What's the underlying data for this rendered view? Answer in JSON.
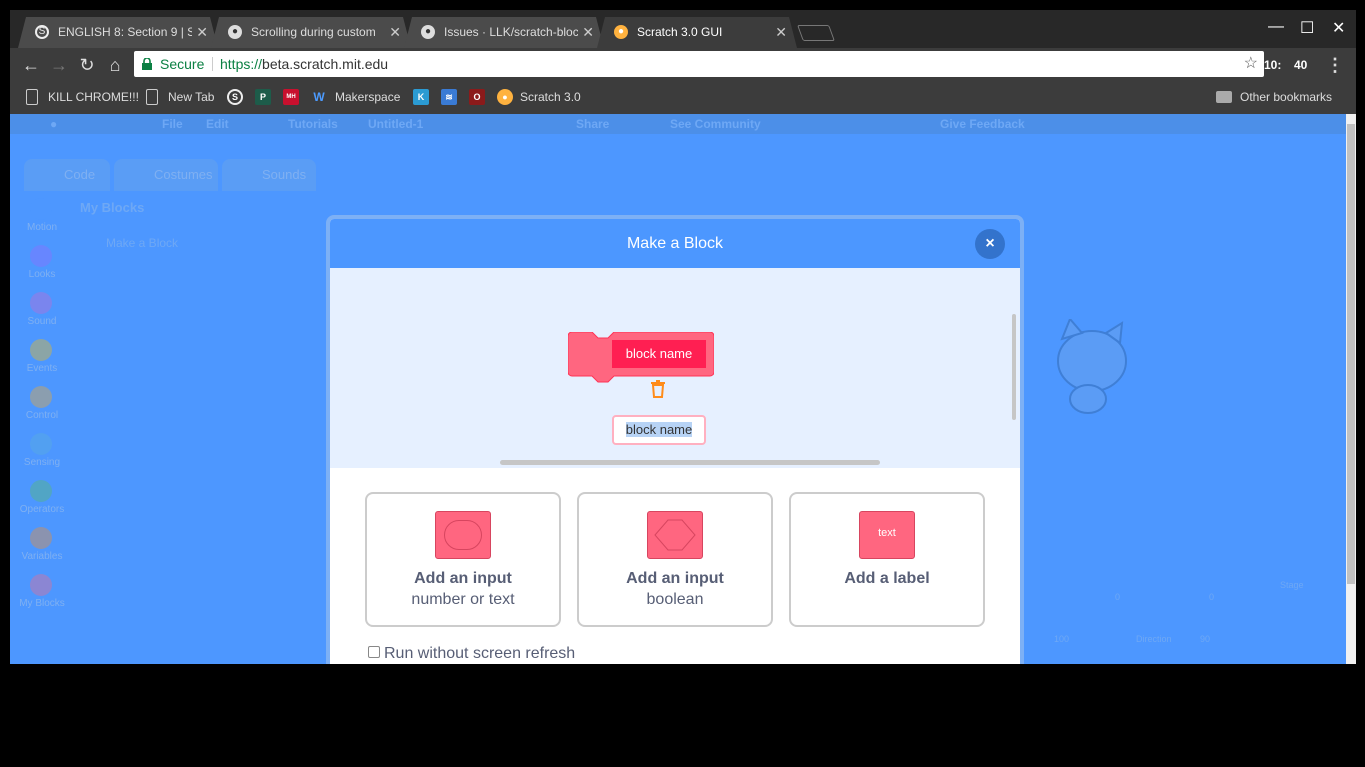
{
  "browser": {
    "tabs": [
      {
        "title": "ENGLISH 8: Section 9 | Sc",
        "icon": "schoology-icon"
      },
      {
        "title": "Scrolling during custom",
        "icon": "github-icon"
      },
      {
        "title": "Issues · LLK/scratch-bloc",
        "icon": "github-icon"
      },
      {
        "title": "Scratch 3.0 GUI",
        "icon": "scratch-cat-icon"
      }
    ],
    "close_glyph": "✕",
    "window_controls": [
      "—",
      "☐",
      "✕"
    ],
    "secure_label": "Secure",
    "url_scheme": "https://",
    "url_host": "beta.scratch.mit.edu",
    "clock_hour": "10:",
    "clock_min": "40",
    "bookmarks": [
      "KILL CHROME!!!",
      "New Tab",
      "Makerspace",
      "Scratch 3.0"
    ],
    "other_bookmarks": "Other bookmarks"
  },
  "scratch": {
    "menu": [
      "File",
      "Edit",
      "Tutorials",
      "Untitled-1",
      "Share",
      "See Community",
      "Give Feedback"
    ],
    "tabs": [
      "Code",
      "Costumes",
      "Sounds"
    ],
    "palette_title": "My Blocks",
    "make_block_button": "Make a Block",
    "categories": [
      {
        "label": "Motion",
        "color": "#4c97ff"
      },
      {
        "label": "Looks",
        "color": "#9966ff"
      },
      {
        "label": "Sound",
        "color": "#cf63cf"
      },
      {
        "label": "Events",
        "color": "#ffbf00"
      },
      {
        "label": "Control",
        "color": "#ffab19"
      },
      {
        "label": "Sensing",
        "color": "#5cb1d6"
      },
      {
        "label": "Operators",
        "color": "#59c059"
      },
      {
        "label": "Variables",
        "color": "#ff8c1a"
      },
      {
        "label": "My Blocks",
        "color": "#ff6680"
      }
    ],
    "sprite_fields": {
      "x": "0",
      "y": "0",
      "size": "100",
      "direction_label": "Direction",
      "direction": "90",
      "stage_label": "Stage"
    }
  },
  "modal": {
    "title": "Make a Block",
    "close_glyph": "×",
    "block_label": "block name",
    "name_input_value": "block name",
    "options": [
      {
        "title": "Add an input",
        "subtitle": "number or text",
        "icon": "round-input-icon"
      },
      {
        "title": "Add an input",
        "subtitle": "boolean",
        "icon": "hexagon-input-icon"
      },
      {
        "title": "Add a label",
        "subtitle": "",
        "icon_text": "text"
      }
    ],
    "run_without_refresh": "Run without screen refresh",
    "run_without_refresh_checked": false
  },
  "colors": {
    "accent": "#4c97ff",
    "block": "#ff6680",
    "block_dark": "#ff1f52",
    "overlay": "#4d97ff"
  }
}
